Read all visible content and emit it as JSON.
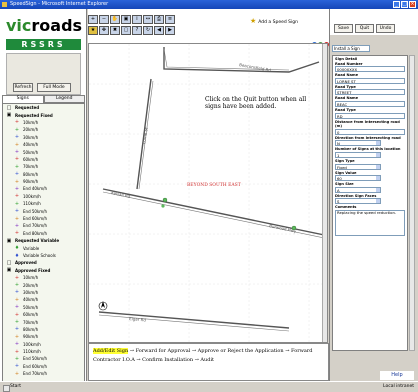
{
  "window": {
    "title": "SpeedSign - Microsoft Internet Explorer"
  },
  "logo": {
    "part1": "vic",
    "part2": "roads"
  },
  "banner": "RSSRS",
  "sidebar": {
    "refresh": "Refresh",
    "button2": "Full Mode",
    "tabs": [
      "Signs",
      "Legend"
    ],
    "legend": [
      {
        "sym": "□",
        "text": "Requested",
        "kind": "head"
      },
      {
        "sym": "▣",
        "text": "Requested Fixed",
        "kind": "head"
      },
      {
        "sym": "+",
        "text": "10km/h",
        "kind": "sub",
        "color": "#d03030"
      },
      {
        "sym": "+",
        "text": "20km/h",
        "kind": "sub",
        "color": "#30a030"
      },
      {
        "sym": "+",
        "text": "30km/h",
        "kind": "sub",
        "color": "#3050d0"
      },
      {
        "sym": "+",
        "text": "40km/h",
        "kind": "sub",
        "color": "#d08020"
      },
      {
        "sym": "+",
        "text": "50km/h",
        "kind": "sub",
        "color": "#8030c0"
      },
      {
        "sym": "+",
        "text": "60km/h",
        "kind": "sub",
        "color": "#d03030"
      },
      {
        "sym": "+",
        "text": "70km/h",
        "kind": "sub",
        "color": "#30a030"
      },
      {
        "sym": "+",
        "text": "80km/h",
        "kind": "sub",
        "color": "#3050d0"
      },
      {
        "sym": "+",
        "text": "90km/h",
        "kind": "sub",
        "color": "#d08020"
      },
      {
        "sym": "+",
        "text": "End 40km/h",
        "kind": "sub",
        "color": "#8030c0"
      },
      {
        "sym": "+",
        "text": "100km/h",
        "kind": "sub",
        "color": "#d03030"
      },
      {
        "sym": "+",
        "text": "110km/h",
        "kind": "sub",
        "color": "#30a030"
      },
      {
        "sym": "+",
        "text": "End 50km/h",
        "kind": "sub",
        "color": "#3050d0"
      },
      {
        "sym": "+",
        "text": "End 60km/h",
        "kind": "sub",
        "color": "#d08020"
      },
      {
        "sym": "+",
        "text": "End 70km/h",
        "kind": "sub",
        "color": "#8030c0"
      },
      {
        "sym": "+",
        "text": "End 80km/h",
        "kind": "sub",
        "color": "#d03030"
      },
      {
        "sym": "▣",
        "text": "Requested Variable",
        "kind": "head"
      },
      {
        "sym": "♦",
        "text": "Variable",
        "kind": "sub",
        "color": "#30a030"
      },
      {
        "sym": "♦",
        "text": "Variable Schools",
        "kind": "sub",
        "color": "#3050d0"
      },
      {
        "sym": "□",
        "text": "Approved",
        "kind": "head"
      },
      {
        "sym": "▣",
        "text": "Approved Fixed",
        "kind": "head"
      },
      {
        "sym": "+",
        "text": "10km/h",
        "kind": "sub",
        "color": "#d03030"
      },
      {
        "sym": "+",
        "text": "20km/h",
        "kind": "sub",
        "color": "#30a030"
      },
      {
        "sym": "+",
        "text": "30km/h",
        "kind": "sub",
        "color": "#3050d0"
      },
      {
        "sym": "+",
        "text": "40km/h",
        "kind": "sub",
        "color": "#d08020"
      },
      {
        "sym": "+",
        "text": "50km/h",
        "kind": "sub",
        "color": "#8030c0"
      },
      {
        "sym": "+",
        "text": "60km/h",
        "kind": "sub",
        "color": "#d03030"
      },
      {
        "sym": "+",
        "text": "70km/h",
        "kind": "sub",
        "color": "#30a030"
      },
      {
        "sym": "+",
        "text": "80km/h",
        "kind": "sub",
        "color": "#3050d0"
      },
      {
        "sym": "+",
        "text": "90km/h",
        "kind": "sub",
        "color": "#d08020"
      },
      {
        "sym": "+",
        "text": "100km/h",
        "kind": "sub",
        "color": "#8030c0"
      },
      {
        "sym": "+",
        "text": "110km/h",
        "kind": "sub",
        "color": "#d03030"
      },
      {
        "sym": "+",
        "text": "End 50km/h",
        "kind": "sub",
        "color": "#30a030"
      },
      {
        "sym": "+",
        "text": "End 60km/h",
        "kind": "sub",
        "color": "#3050d0"
      },
      {
        "sym": "+",
        "text": "End 70km/h",
        "kind": "sub",
        "color": "#d08020"
      }
    ]
  },
  "toolbar": {
    "hint": "Add a Speed Sign",
    "icons": [
      "zoom-in-icon",
      "zoom-out-icon",
      "pan-icon",
      "full-extent-icon",
      "identify-icon",
      "measure-icon",
      "print-icon",
      "layers-icon",
      "add-sign-icon",
      "move-sign-icon",
      "delete-sign-icon",
      "select-icon",
      "query-icon",
      "refresh-map-icon",
      "back-icon",
      "forward-icon"
    ],
    "icon_glyphs": [
      "+",
      "−",
      "✋",
      "▣",
      "i",
      "↔",
      "⎙",
      "≡",
      "★",
      "✥",
      "✖",
      "▢",
      "?",
      "↻",
      "◀",
      "▶"
    ]
  },
  "map": {
    "note": "Click on the Quit button when all signs have been added.",
    "red_label": "BEYOND SOUTH EAST",
    "road_labels": [
      "Beaconsfield Rd",
      "Lorne St",
      "Kelsall Rd",
      "Burwood Hwy",
      "Elgar Rd"
    ]
  },
  "rpanel": {
    "buttons": [
      "Save",
      "Quit",
      "Undo"
    ],
    "select": "Install a Sign",
    "fields": [
      {
        "label": "Sign Detail",
        "value": ""
      },
      {
        "label": "Road Number",
        "value": "0000XXXX"
      },
      {
        "label": "Road Name",
        "value": "LORNE ST"
      },
      {
        "label": "Road Type",
        "value": "STREET"
      },
      {
        "label": "Road Name",
        "value": "BEAC"
      },
      {
        "label": "Road Type",
        "value": "RD"
      },
      {
        "label": "Distance from Intersecting road (m)",
        "value": "0"
      },
      {
        "label": "Direction from Intersecting road",
        "value": "N",
        "dd": true
      },
      {
        "label": "Number of Signs at this location",
        "value": "1",
        "dd": true
      },
      {
        "label": "Sign Type",
        "value": "Fixed",
        "dd": true
      },
      {
        "label": "Sign Value",
        "value": "60",
        "dd": true
      },
      {
        "label": "Sign Size",
        "value": "A",
        "dd": true
      },
      {
        "label": "Direction Sign Faces",
        "value": "S",
        "dd": true
      },
      {
        "label": "Comments",
        "value": "Replacing the speed reduction.",
        "ta": true
      }
    ],
    "help": "Help"
  },
  "status": {
    "highlight": "Add/Edit Sign",
    "text": "→ Forward for Approval → Approve or Reject the Application → Forward Contractor I.O.A → Confirm Installation → Audit"
  },
  "taskbar": {
    "start": "Start",
    "tray": "Local intranet"
  }
}
